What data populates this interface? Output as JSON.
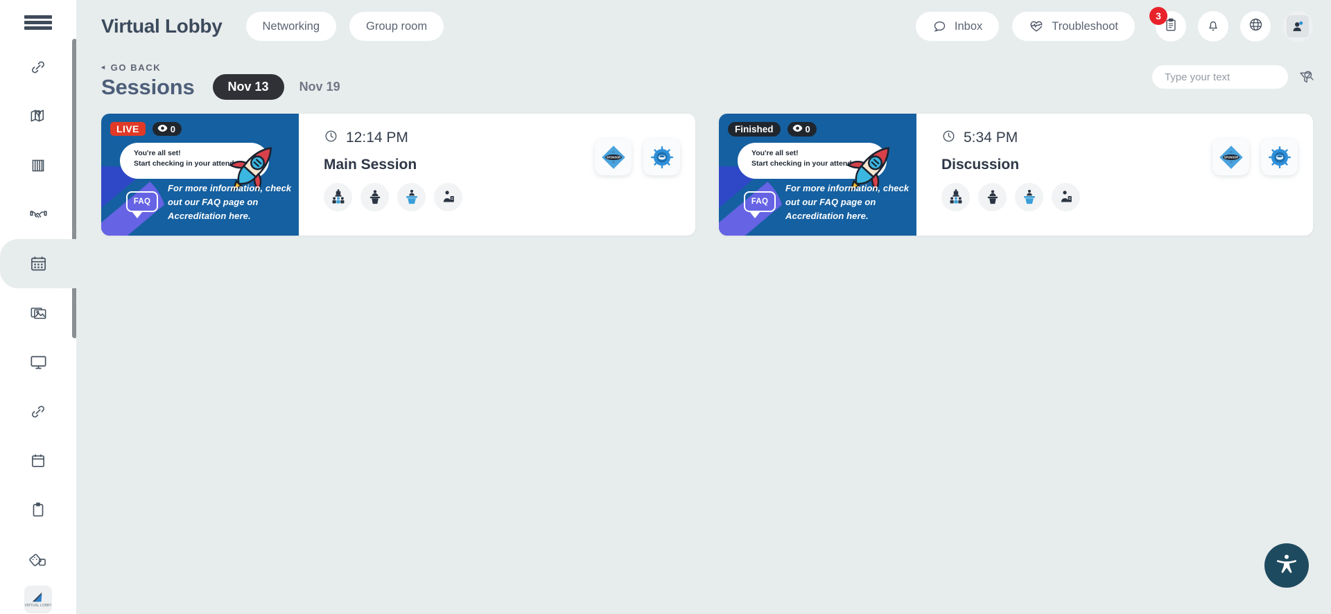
{
  "sidebar": {
    "menu_icon": "hamburger-icon",
    "items": [
      {
        "icon": "link-icon",
        "name": "sidebar-item-link",
        "active": false
      },
      {
        "icon": "map-icon",
        "name": "sidebar-item-map",
        "active": false
      },
      {
        "icon": "banner-icon",
        "name": "sidebar-item-banner",
        "active": false
      },
      {
        "icon": "handshake-icon",
        "name": "sidebar-item-sponsors",
        "active": false
      },
      {
        "icon": "calendar-grid-icon",
        "name": "sidebar-item-sessions",
        "active": true
      },
      {
        "icon": "photos-icon",
        "name": "sidebar-item-gallery",
        "active": false
      },
      {
        "icon": "monitor-icon",
        "name": "sidebar-item-screen",
        "active": false
      },
      {
        "icon": "link-icon",
        "name": "sidebar-item-links",
        "active": false
      },
      {
        "icon": "calendar-icon",
        "name": "sidebar-item-agenda",
        "active": false
      },
      {
        "icon": "clipboard-icon",
        "name": "sidebar-item-notes",
        "active": false
      },
      {
        "icon": "dice-icon",
        "name": "sidebar-item-games",
        "active": false
      }
    ],
    "logo_label": "VIRTUAL LOBBY"
  },
  "header": {
    "title": "Virtual Lobby",
    "tabs": [
      {
        "label": "Networking"
      },
      {
        "label": "Group room"
      }
    ],
    "actions": [
      {
        "label": "Inbox",
        "icon": "chat-bubble-icon"
      },
      {
        "label": "Troubleshoot",
        "icon": "heart-pulse-icon"
      }
    ],
    "icons": [
      {
        "name": "clipboard-icon",
        "badge": "3"
      },
      {
        "name": "bell-icon",
        "badge": ""
      },
      {
        "name": "globe-icon",
        "badge": ""
      },
      {
        "name": "user-avatar-icon",
        "badge": ""
      }
    ]
  },
  "page": {
    "go_back": "GO BACK",
    "go_back_caret": "◂",
    "title": "Sessions",
    "date_tabs": [
      {
        "label": "Nov 13",
        "selected": true
      },
      {
        "label": "Nov 19",
        "selected": false
      }
    ],
    "search": {
      "placeholder": "Type your text",
      "value": "",
      "icon": "search-icon",
      "filter_icon": "filter-icon"
    }
  },
  "thumbnail": {
    "bubble_line1": "You're all set!",
    "bubble_line2": "Start checking in your attendees.",
    "faq_label": "FAQ",
    "note_line1": "For more information, check",
    "note_line2": "out our FAQ page on",
    "note_line3": "Accreditation here.",
    "background_color": "#1560a0"
  },
  "sessions": [
    {
      "status": "LIVE",
      "status_type": "live",
      "views": "0",
      "time": "12:14 PM",
      "name": "Main Session",
      "clock_icon": "clock-icon",
      "eye_icon": "eye-icon",
      "avatars": [
        {
          "name": "avatar-speaker-1",
          "label": "Speaker"
        },
        {
          "name": "avatar-speaker-2",
          "label": "Speaker"
        },
        {
          "name": "avatar-speaker-3",
          "label": "Speaker"
        },
        {
          "name": "avatar-speaker-4",
          "label": "Speaker"
        }
      ],
      "sponsors": [
        {
          "name": "sponsor-diamond-badge",
          "label": "SPONSOR"
        },
        {
          "name": "sponsor-seal-badge",
          "label": ""
        }
      ]
    },
    {
      "status": "Finished",
      "status_type": "finished",
      "views": "0",
      "time": "5:34 PM",
      "name": "Discussion",
      "clock_icon": "clock-icon",
      "eye_icon": "eye-icon",
      "avatars": [
        {
          "name": "avatar-speaker-1",
          "label": "Speaker"
        },
        {
          "name": "avatar-speaker-2",
          "label": "Speaker"
        },
        {
          "name": "avatar-speaker-3",
          "label": "Speaker"
        },
        {
          "name": "avatar-speaker-4",
          "label": "Speaker"
        }
      ],
      "sponsors": [
        {
          "name": "sponsor-diamond-badge",
          "label": "SPONSOR"
        },
        {
          "name": "sponsor-seal-badge",
          "label": ""
        }
      ]
    }
  ],
  "accessibility": {
    "icon": "accessibility-person-icon",
    "color": "#1e4a5f"
  },
  "colors": {
    "page_background": "#e7ecec",
    "accent_blue": "#1560a0",
    "live_red": "#e03a26",
    "badge_red": "#e8222a",
    "dark_pill": "#2f3136",
    "title_blue": "#4d5e79"
  }
}
